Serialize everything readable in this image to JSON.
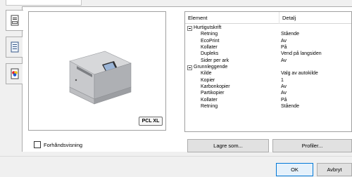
{
  "properties": {
    "header": {
      "element": "Element",
      "detail": "Detalj"
    },
    "rows": [
      {
        "kind": "group",
        "name": "Hurtigutskrift",
        "value": ""
      },
      {
        "kind": "item",
        "name": "Retning",
        "value": "Stående"
      },
      {
        "kind": "item",
        "name": "EcoPrint",
        "value": "Av"
      },
      {
        "kind": "item",
        "name": "Kollater",
        "value": "På"
      },
      {
        "kind": "item",
        "name": "Dupleks",
        "value": "Vend på langsiden"
      },
      {
        "kind": "item",
        "name": "Sider per ark",
        "value": "Av"
      },
      {
        "kind": "group",
        "name": "Grunnleggende",
        "value": ""
      },
      {
        "kind": "item",
        "name": "Kilde",
        "value": "Valg av autokilde"
      },
      {
        "kind": "item",
        "name": "Kopier",
        "value": "1"
      },
      {
        "kind": "item",
        "name": "Karbonkopier",
        "value": "Av"
      },
      {
        "kind": "item",
        "name": "Partikopier",
        "value": "Av"
      },
      {
        "kind": "item",
        "name": "Kollater",
        "value": "På"
      },
      {
        "kind": "item",
        "name": "Retning",
        "value": "Stående"
      }
    ]
  },
  "preview": {
    "badge": "PCL XL"
  },
  "options": {
    "preview_checkbox_label": "Forhåndsvisning",
    "preview_checked": false
  },
  "buttons": {
    "save_as": "Lagre som...",
    "profiles": "Profiler...",
    "ok": "OK",
    "cancel": "Avbryt"
  },
  "side_tabs": [
    {
      "icon": "printer-document-icon",
      "active": true
    },
    {
      "icon": "list-document-icon",
      "active": false
    },
    {
      "icon": "color-palette-icon",
      "active": false
    }
  ]
}
